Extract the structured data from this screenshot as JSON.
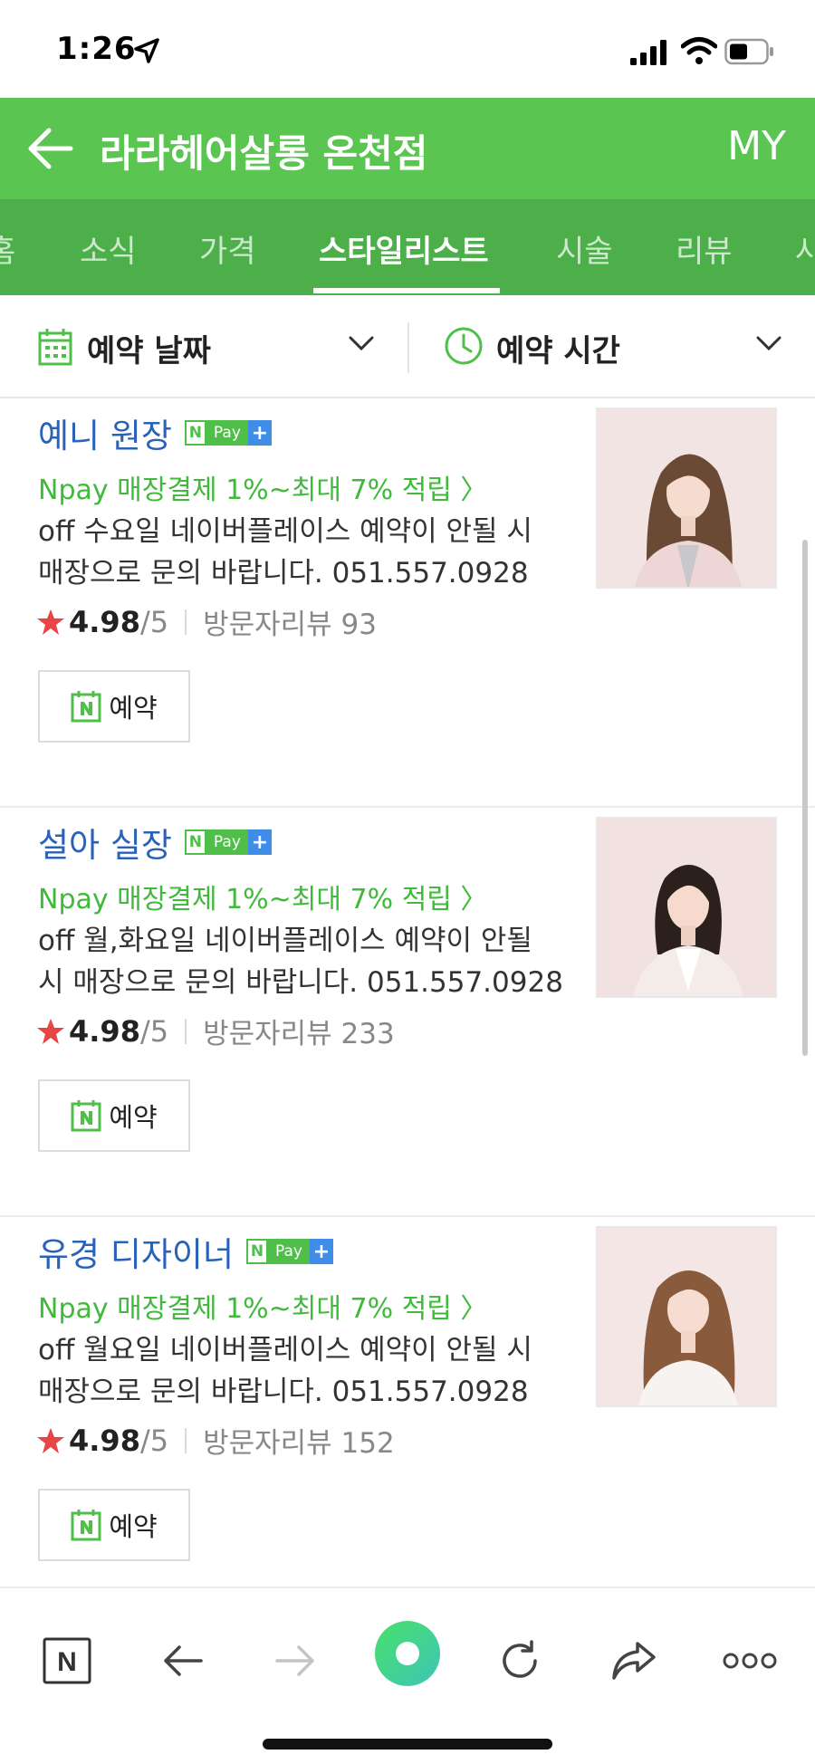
{
  "status": {
    "time": "1:26"
  },
  "header": {
    "title": "라라헤어살롱 온천점",
    "my": "MY"
  },
  "tabs": [
    {
      "label": "홈"
    },
    {
      "label": "소식"
    },
    {
      "label": "가격"
    },
    {
      "label": "스타일리스트",
      "active": true
    },
    {
      "label": "시술"
    },
    {
      "label": "리뷰"
    },
    {
      "label": "사"
    }
  ],
  "filters": {
    "date_label": "예약 날짜",
    "time_label": "예약 시간"
  },
  "colors": {
    "brand_green": "#5bc552",
    "tab_green": "#4caf49",
    "name_blue": "#2a62b8",
    "promo_green": "#3fba3a",
    "star_red": "#e84545"
  },
  "npay_badge": {
    "n": "N",
    "pay": "Pay",
    "plus": "+"
  },
  "stylists": [
    {
      "name": "예니 원장",
      "promo": "Npay 매장결제 1%~최대 7% 적립",
      "desc": "off 수요일 네이버플레이스 예약이 안될 시 매장으로 문의 바랍니다. 051.557.0928",
      "rating": "4.98",
      "rating_max": "/5",
      "reviews": "방문자리뷰 93",
      "reserve": "예약",
      "hair_color": "#6b4a35",
      "outfit_color": "#efd6d6"
    },
    {
      "name": "설아 실장",
      "promo": "Npay 매장결제 1%~최대 7% 적립",
      "desc": "off 월,화요일 네이버플레이스 예약이 안될 시 매장으로 문의 바랍니다. 051.557.0928",
      "rating": "4.98",
      "rating_max": "/5",
      "reviews": "방문자리뷰 233",
      "reserve": "예약",
      "hair_color": "#2b201c",
      "outfit_color": "#f3ece8"
    },
    {
      "name": "유경 디자이너",
      "promo": "Npay 매장결제 1%~최대 7% 적립",
      "desc": "off 월요일 네이버플레이스 예약이 안될 시 매장으로 문의 바랍니다. 051.557.0928",
      "rating": "4.98",
      "rating_max": "/5",
      "reviews": "방문자리뷰 152",
      "reserve": "예약",
      "hair_color": "#8a5a3c",
      "outfit_color": "#f7f3f0"
    }
  ],
  "toolbar": {
    "home": "N"
  }
}
